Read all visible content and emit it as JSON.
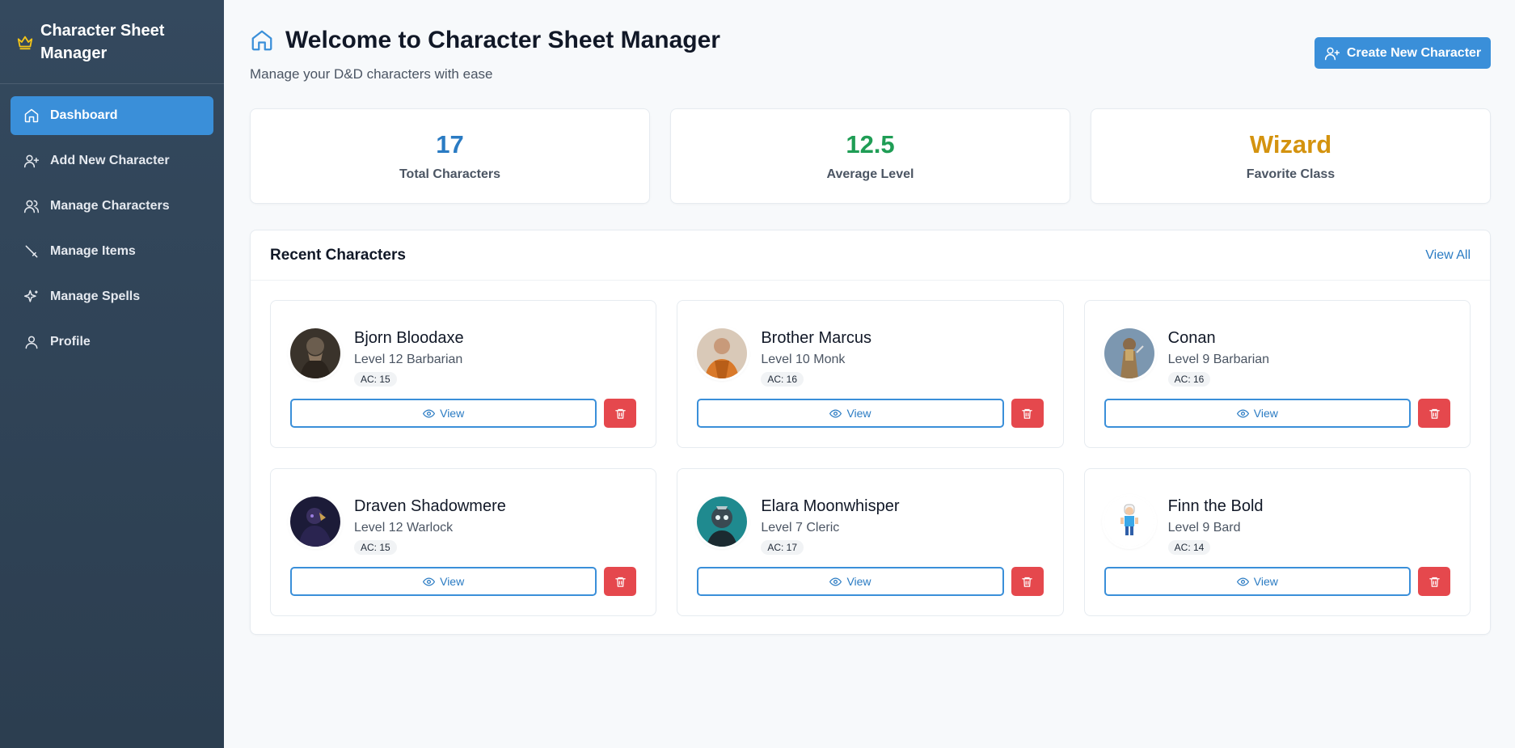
{
  "app": {
    "title": "Character Sheet Manager",
    "brand_icon": "crown-icon"
  },
  "colors": {
    "sidebar": "#2c3e50",
    "accent": "#3a8fd9",
    "danger": "#e5484d",
    "stat_blue": "#2a7bc3",
    "stat_green": "#1f9d55",
    "stat_gold": "#d4930f"
  },
  "sidebar": {
    "items": [
      {
        "label": "Dashboard",
        "icon": "home-icon",
        "active": true
      },
      {
        "label": "Add New Character",
        "icon": "user-plus-icon"
      },
      {
        "label": "Manage Characters",
        "icon": "users-icon"
      },
      {
        "label": "Manage Items",
        "icon": "sword-icon"
      },
      {
        "label": "Manage Spells",
        "icon": "sparkles-icon"
      },
      {
        "label": "Profile",
        "icon": "user-icon"
      }
    ]
  },
  "header": {
    "title": "Welcome to Character Sheet Manager",
    "subtitle": "Manage your D&D characters with ease",
    "create_button": "Create New Character"
  },
  "stats": [
    {
      "value": "17",
      "label": "Total Characters"
    },
    {
      "value": "12.5",
      "label": "Average Level"
    },
    {
      "value": "Wizard",
      "label": "Favorite Class"
    }
  ],
  "recent": {
    "title": "Recent Characters",
    "view_all": "View All",
    "view_label": "View",
    "characters": [
      {
        "name": "Bjorn Bloodaxe",
        "class": "Level 12 Barbarian",
        "ac": "AC: 15"
      },
      {
        "name": "Brother Marcus",
        "class": "Level 10 Monk",
        "ac": "AC: 16"
      },
      {
        "name": "Conan",
        "class": "Level 9 Barbarian",
        "ac": "AC: 16"
      },
      {
        "name": "Draven Shadowmere",
        "class": "Level 12 Warlock",
        "ac": "AC: 15"
      },
      {
        "name": "Elara Moonwhisper",
        "class": "Level 7 Cleric",
        "ac": "AC: 17"
      },
      {
        "name": "Finn the Bold",
        "class": "Level 9 Bard",
        "ac": "AC: 14"
      }
    ]
  }
}
